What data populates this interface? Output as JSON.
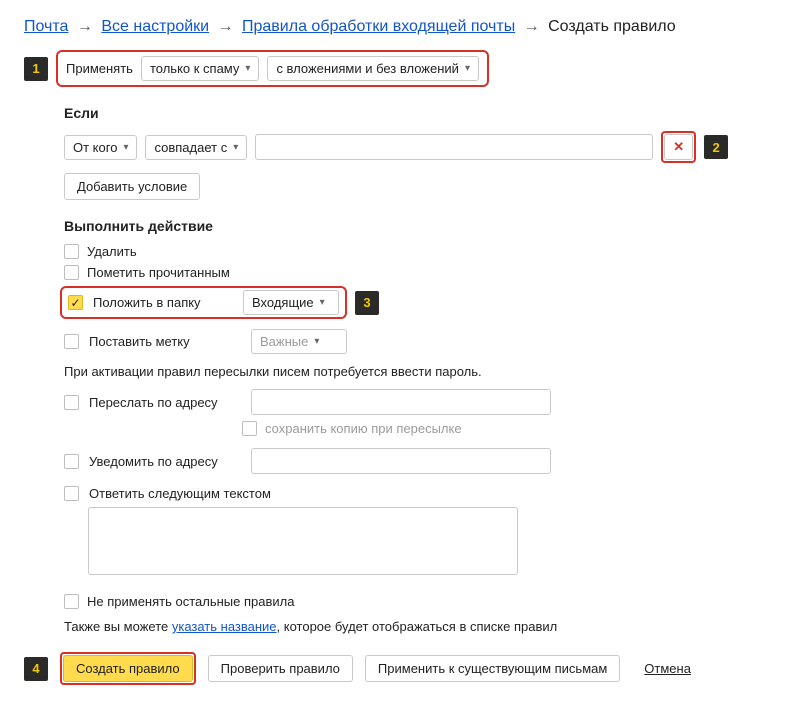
{
  "breadcrumb": {
    "items": [
      "Почта",
      "Все настройки",
      "Правила обработки входящей почты"
    ],
    "current": "Создать правило"
  },
  "callouts": {
    "one": "1",
    "two": "2",
    "three": "3",
    "four": "4"
  },
  "apply": {
    "label": "Применять",
    "scope_select": "только к спаму",
    "attach_select": "с вложениями и без вложений"
  },
  "if": {
    "title": "Если",
    "field_select": "От кого",
    "op_select": "совпадает с",
    "value": "",
    "add_condition": "Добавить условие"
  },
  "action": {
    "title": "Выполнить действие",
    "delete": "Удалить",
    "mark_read": "Пометить прочитанным",
    "move_to_folder": "Положить в папку",
    "folder_select": "Входящие",
    "set_label": "Поставить метку",
    "label_select": "Важные",
    "forward_note": "При активации правил пересылки писем потребуется ввести пароль.",
    "forward_to": "Переслать по адресу",
    "forward_value": "",
    "keep_copy": "сохранить копию при пересылке",
    "notify_to": "Уведомить по адресу",
    "notify_value": "",
    "reply_with": "Ответить следующим текстом",
    "reply_value": "",
    "stop_rules": "Не применять остальные правила"
  },
  "name_hint": {
    "prefix": "Также вы можете ",
    "link": "указать название",
    "suffix": ", которое будет отображаться в списке правил"
  },
  "footer": {
    "create": "Создать правило",
    "test": "Проверить правило",
    "apply_existing": "Применить к существующим письмам",
    "cancel": "Отмена"
  }
}
